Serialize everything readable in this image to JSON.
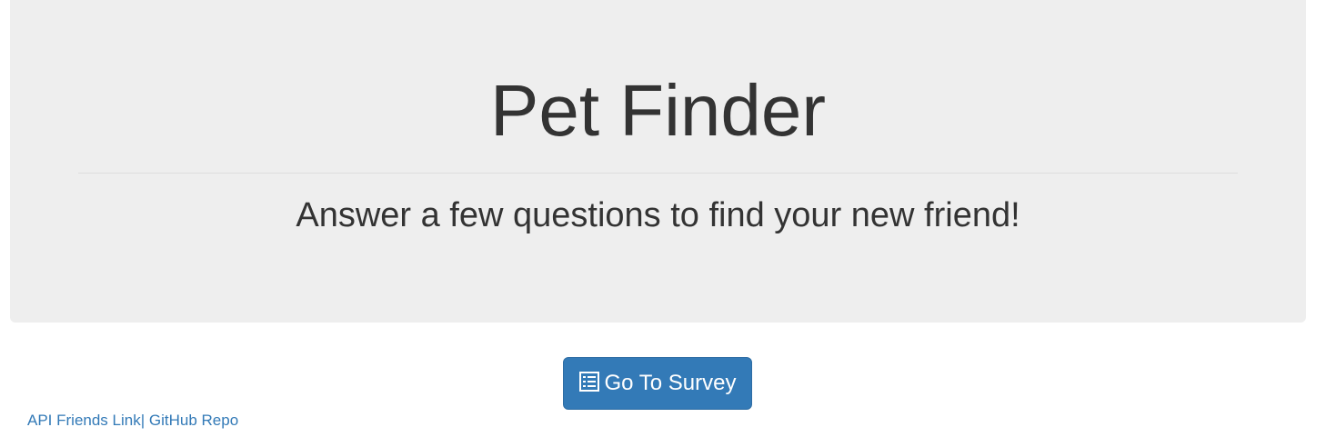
{
  "header": {
    "title": "Pet Finder",
    "subtitle": "Answer a few questions to find your new friend!"
  },
  "actions": {
    "survey_button_label": "Go To Survey",
    "survey_button_icon": "list-alt-icon"
  },
  "footer": {
    "api_link_label": "API Friends Link",
    "separator": "|",
    "github_link_label": "GitHub Repo"
  },
  "colors": {
    "jumbotron_bg": "#eeeeee",
    "primary": "#337ab7",
    "text": "#333333"
  }
}
